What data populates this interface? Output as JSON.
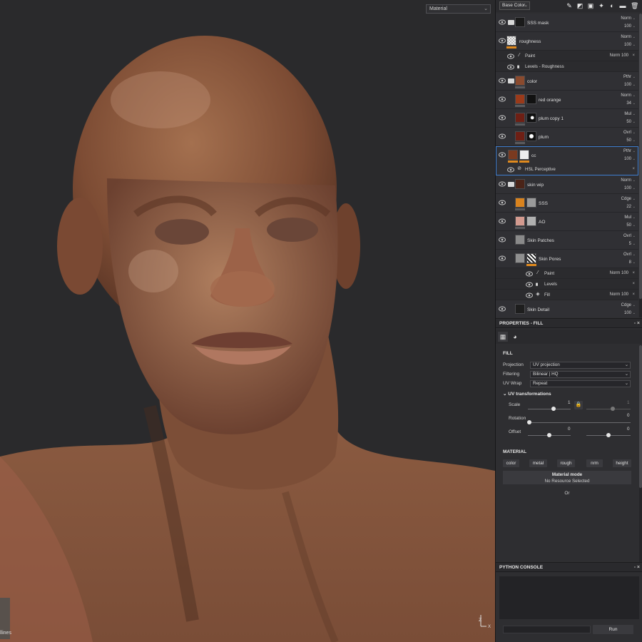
{
  "viewport": {
    "channel_select": "Material",
    "bottom_left_label": "llines",
    "axis_labels": {
      "z": "Z",
      "x": "X"
    }
  },
  "layers_toolbar": {
    "channel_dropdown": "Base Color",
    "icons": [
      "brush-icon",
      "add-fill-layer-icon",
      "add-paint-layer-icon",
      "add-effect-icon",
      "add-mask-icon",
      "add-folder-icon",
      "delete-icon"
    ]
  },
  "layers": [
    {
      "name": "SSS mask",
      "blend": "Norm",
      "opacity": "100",
      "type": "folder"
    },
    {
      "name": "roughness",
      "blend": "Norm",
      "opacity": "100",
      "type": "layer"
    },
    {
      "name": "color",
      "blend": "Pthr",
      "opacity": "100",
      "type": "folder"
    },
    {
      "name": "red orange",
      "blend": "Norm",
      "opacity": "34",
      "type": "layer"
    },
    {
      "name": "plum copy 1",
      "blend": "Mul",
      "opacity": "50",
      "type": "layer"
    },
    {
      "name": "plum",
      "blend": "Ovrl",
      "opacity": "50",
      "type": "layer"
    },
    {
      "name": "cc",
      "blend": "Pthr",
      "opacity": "100",
      "type": "layer"
    },
    {
      "name": "skin wip",
      "blend": "Norm",
      "opacity": "100",
      "type": "folder"
    },
    {
      "name": "SSS",
      "blend": "Cdge",
      "opacity": "22",
      "type": "layer"
    },
    {
      "name": "AO",
      "blend": "Mul",
      "opacity": "50",
      "type": "layer"
    },
    {
      "name": "Skin Patches",
      "blend": "Ovrl",
      "opacity": "5",
      "type": "layer"
    },
    {
      "name": "Skin Pores",
      "blend": "Ovrl",
      "opacity": "8",
      "type": "layer"
    },
    {
      "name": "Skin Detail",
      "blend": "Cdge",
      "opacity": "100",
      "type": "layer"
    }
  ],
  "sublayers": {
    "roughness_paint": {
      "name": "Paint",
      "blend": "Norm",
      "opacity": "100"
    },
    "roughness_levels": {
      "name": "Levels - Roughness"
    },
    "cc_hsl": {
      "name": "HSL Perceptive"
    },
    "pores_paint": {
      "name": "Paint",
      "blend": "Norm",
      "opacity": "100"
    },
    "pores_levels": {
      "name": "Levels"
    },
    "pores_fill": {
      "name": "Fill",
      "blend": "Norm",
      "opacity": "100"
    }
  },
  "properties": {
    "header": "PROPERTIES - FILL",
    "fill_title": "FILL",
    "projection_label": "Projection",
    "projection_value": "UV projection",
    "filtering_label": "Filtering",
    "filtering_value": "Bilinear | HQ",
    "uvwrap_label": "UV Wrap",
    "uvwrap_value": "Repeat",
    "uv_transform_title": "UV transformations",
    "scale_label": "Scale",
    "scale_value": "1",
    "scale_value_locked": "1",
    "rotation_label": "Rotation",
    "rotation_value": "0",
    "offset_label": "Offset",
    "offset_u": "0",
    "offset_v": "0",
    "material_title": "MATERIAL",
    "material_channels": [
      "color",
      "metal",
      "rough",
      "nrm",
      "height"
    ],
    "material_mode_title": "Material mode",
    "material_mode_value": "No Resource Selected",
    "or_text": "Or"
  },
  "console": {
    "header": "PYTHON CONSOLE",
    "run_label": "Run"
  },
  "colors": {
    "accent_orange": "#e08a1e",
    "selection_blue": "#3f7fd0",
    "panel_bg": "#2e2e31",
    "viewport_bg": "#2a2a2c"
  }
}
